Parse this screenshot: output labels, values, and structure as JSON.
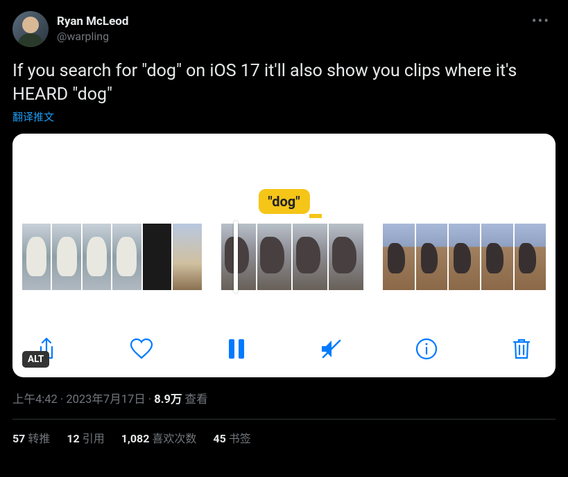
{
  "user": {
    "display_name": "Ryan McLeod",
    "handle": "@warpling"
  },
  "body": "If you search for \"dog\" on iOS 17 it'll also show you clips where it's HEARD \"dog\"",
  "translate_label": "翻译推文",
  "media": {
    "search_label": "\"dog\"",
    "alt_badge": "ALT"
  },
  "meta": {
    "time": "上午4:42",
    "sep1": " · ",
    "date": "2023年7月17日",
    "sep2": " · ",
    "views_count": "8.9万",
    "views_suffix": " 查看"
  },
  "stats": {
    "retweets_count": "57",
    "retweets_label": "转推",
    "quotes_count": "12",
    "quotes_label": "引用",
    "likes_count": "1,082",
    "likes_label": "喜欢次数",
    "bookmarks_count": "45",
    "bookmarks_label": "书签"
  }
}
